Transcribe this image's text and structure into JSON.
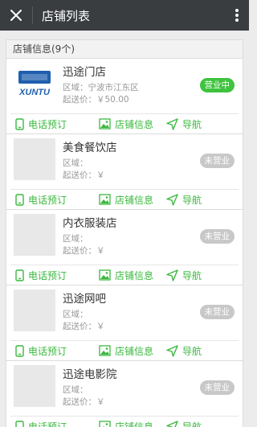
{
  "header": {
    "title": "店铺列表"
  },
  "list": {
    "header": "店铺信息(9个)",
    "stores": [
      {
        "name": "迅途门店",
        "area": "区域：宁波市江东区",
        "price": "起送价：￥50.00",
        "status": "营业中",
        "open": true,
        "logo": "XUNTU"
      },
      {
        "name": "美食餐饮店",
        "area": "区域：",
        "price": "起送价：￥",
        "status": "未营业",
        "open": false
      },
      {
        "name": "内衣服装店",
        "area": "区域：",
        "price": "起送价：￥",
        "status": "未营业",
        "open": false
      },
      {
        "name": "迅途网吧",
        "area": "区域：",
        "price": "起送价：￥",
        "status": "未营业",
        "open": false
      },
      {
        "name": "迅途电影院",
        "area": "区域：",
        "price": "起送价：￥",
        "status": "未营业",
        "open": false
      }
    ],
    "actions": {
      "call": "电话预订",
      "info": "店铺信息",
      "nav": "导航"
    }
  },
  "colors": {
    "accent": "#3bb83f",
    "topbar": "#3a3d40",
    "open_badge": "#3ec33e",
    "closed_badge": "#c8c8c8"
  },
  "icons": {
    "close": "close-icon",
    "more": "more-vertical-icon",
    "call": "phone-icon",
    "info": "image-icon",
    "nav": "navigation-arrow-icon"
  }
}
